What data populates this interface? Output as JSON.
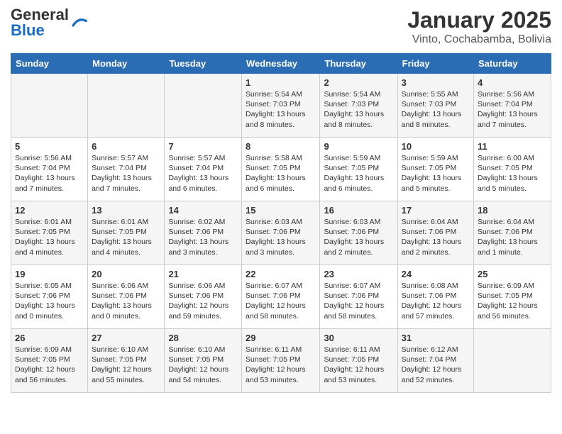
{
  "header": {
    "logo_general": "General",
    "logo_blue": "Blue",
    "month_title": "January 2025",
    "location": "Vinto, Cochabamba, Bolivia"
  },
  "days_of_week": [
    "Sunday",
    "Monday",
    "Tuesday",
    "Wednesday",
    "Thursday",
    "Friday",
    "Saturday"
  ],
  "weeks": [
    [
      {
        "day": "",
        "info": ""
      },
      {
        "day": "",
        "info": ""
      },
      {
        "day": "",
        "info": ""
      },
      {
        "day": "1",
        "info": "Sunrise: 5:54 AM\nSunset: 7:03 PM\nDaylight: 13 hours and 8 minutes."
      },
      {
        "day": "2",
        "info": "Sunrise: 5:54 AM\nSunset: 7:03 PM\nDaylight: 13 hours and 8 minutes."
      },
      {
        "day": "3",
        "info": "Sunrise: 5:55 AM\nSunset: 7:03 PM\nDaylight: 13 hours and 8 minutes."
      },
      {
        "day": "4",
        "info": "Sunrise: 5:56 AM\nSunset: 7:04 PM\nDaylight: 13 hours and 7 minutes."
      }
    ],
    [
      {
        "day": "5",
        "info": "Sunrise: 5:56 AM\nSunset: 7:04 PM\nDaylight: 13 hours and 7 minutes."
      },
      {
        "day": "6",
        "info": "Sunrise: 5:57 AM\nSunset: 7:04 PM\nDaylight: 13 hours and 7 minutes."
      },
      {
        "day": "7",
        "info": "Sunrise: 5:57 AM\nSunset: 7:04 PM\nDaylight: 13 hours and 6 minutes."
      },
      {
        "day": "8",
        "info": "Sunrise: 5:58 AM\nSunset: 7:05 PM\nDaylight: 13 hours and 6 minutes."
      },
      {
        "day": "9",
        "info": "Sunrise: 5:59 AM\nSunset: 7:05 PM\nDaylight: 13 hours and 6 minutes."
      },
      {
        "day": "10",
        "info": "Sunrise: 5:59 AM\nSunset: 7:05 PM\nDaylight: 13 hours and 5 minutes."
      },
      {
        "day": "11",
        "info": "Sunrise: 6:00 AM\nSunset: 7:05 PM\nDaylight: 13 hours and 5 minutes."
      }
    ],
    [
      {
        "day": "12",
        "info": "Sunrise: 6:01 AM\nSunset: 7:05 PM\nDaylight: 13 hours and 4 minutes."
      },
      {
        "day": "13",
        "info": "Sunrise: 6:01 AM\nSunset: 7:05 PM\nDaylight: 13 hours and 4 minutes."
      },
      {
        "day": "14",
        "info": "Sunrise: 6:02 AM\nSunset: 7:06 PM\nDaylight: 13 hours and 3 minutes."
      },
      {
        "day": "15",
        "info": "Sunrise: 6:03 AM\nSunset: 7:06 PM\nDaylight: 13 hours and 3 minutes."
      },
      {
        "day": "16",
        "info": "Sunrise: 6:03 AM\nSunset: 7:06 PM\nDaylight: 13 hours and 2 minutes."
      },
      {
        "day": "17",
        "info": "Sunrise: 6:04 AM\nSunset: 7:06 PM\nDaylight: 13 hours and 2 minutes."
      },
      {
        "day": "18",
        "info": "Sunrise: 6:04 AM\nSunset: 7:06 PM\nDaylight: 13 hours and 1 minute."
      }
    ],
    [
      {
        "day": "19",
        "info": "Sunrise: 6:05 AM\nSunset: 7:06 PM\nDaylight: 13 hours and 0 minutes."
      },
      {
        "day": "20",
        "info": "Sunrise: 6:06 AM\nSunset: 7:06 PM\nDaylight: 13 hours and 0 minutes."
      },
      {
        "day": "21",
        "info": "Sunrise: 6:06 AM\nSunset: 7:06 PM\nDaylight: 12 hours and 59 minutes."
      },
      {
        "day": "22",
        "info": "Sunrise: 6:07 AM\nSunset: 7:06 PM\nDaylight: 12 hours and 58 minutes."
      },
      {
        "day": "23",
        "info": "Sunrise: 6:07 AM\nSunset: 7:06 PM\nDaylight: 12 hours and 58 minutes."
      },
      {
        "day": "24",
        "info": "Sunrise: 6:08 AM\nSunset: 7:06 PM\nDaylight: 12 hours and 57 minutes."
      },
      {
        "day": "25",
        "info": "Sunrise: 6:09 AM\nSunset: 7:05 PM\nDaylight: 12 hours and 56 minutes."
      }
    ],
    [
      {
        "day": "26",
        "info": "Sunrise: 6:09 AM\nSunset: 7:05 PM\nDaylight: 12 hours and 56 minutes."
      },
      {
        "day": "27",
        "info": "Sunrise: 6:10 AM\nSunset: 7:05 PM\nDaylight: 12 hours and 55 minutes."
      },
      {
        "day": "28",
        "info": "Sunrise: 6:10 AM\nSunset: 7:05 PM\nDaylight: 12 hours and 54 minutes."
      },
      {
        "day": "29",
        "info": "Sunrise: 6:11 AM\nSunset: 7:05 PM\nDaylight: 12 hours and 53 minutes."
      },
      {
        "day": "30",
        "info": "Sunrise: 6:11 AM\nSunset: 7:05 PM\nDaylight: 12 hours and 53 minutes."
      },
      {
        "day": "31",
        "info": "Sunrise: 6:12 AM\nSunset: 7:04 PM\nDaylight: 12 hours and 52 minutes."
      },
      {
        "day": "",
        "info": ""
      }
    ]
  ]
}
